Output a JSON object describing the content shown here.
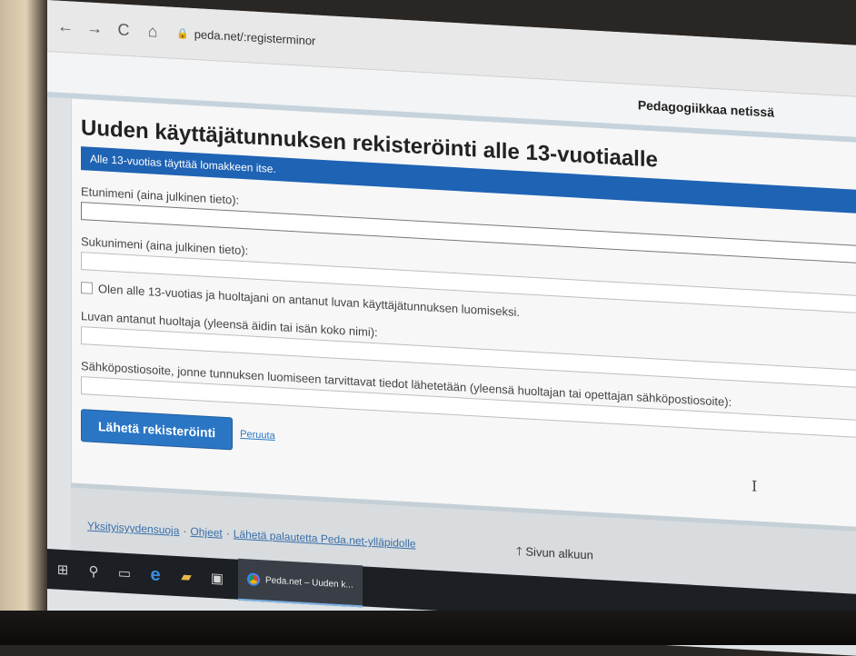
{
  "browser": {
    "url": "peda.net/:registerminor",
    "back_glyph": "←",
    "forward_glyph": "→",
    "reload_glyph": "C",
    "home_glyph": "⌂"
  },
  "site": {
    "tagline": "Pedagogiikkaa netissä"
  },
  "form": {
    "title": "Uuden käyttäjätunnuksen rekisteröinti alle 13-vuotiaalle",
    "info": "Alle 13-vuotias täyttää lomakkeen itse.",
    "fields": [
      {
        "label": "Etunimeni (aina julkinen tieto):",
        "value": ""
      },
      {
        "label": "Sukunimeni (aina julkinen tieto):",
        "value": ""
      },
      {
        "label": "Luvan antanut huoltaja (yleensä äidin tai isän koko nimi):",
        "value": ""
      },
      {
        "label": "Sähköpostiosoite, jonne tunnuksen luomiseen tarvittavat tiedot lähetetään (yleensä huoltajan tai opettajan sähköpostiosoite):",
        "value": ""
      }
    ],
    "consent_label": "Olen alle 13-vuotias ja huoltajani on antanut luvan käyttäjätunnuksen luomiseksi.",
    "consent_checked": false,
    "submit_label": "Lähetä rekisteröinti",
    "cancel_label": "Peruuta"
  },
  "footer": {
    "links": [
      "Yksityisyydensuoja",
      "Ohjeet",
      "Lähetä palautetta Peda.net-ylläpidolle"
    ],
    "separator": "·",
    "to_top_label": "Sivun alkuun",
    "to_top_glyph": "🡑"
  },
  "taskbar": {
    "icons": [
      "windows-start-icon",
      "search-icon",
      "task-view-icon",
      "edge-icon",
      "file-explorer-icon",
      "store-icon"
    ],
    "app_label": "Peda.net – Uuden k..."
  },
  "colors": {
    "accent": "#1e63b4",
    "button": "#2b76c4",
    "taskbar": "#1c1f24"
  }
}
